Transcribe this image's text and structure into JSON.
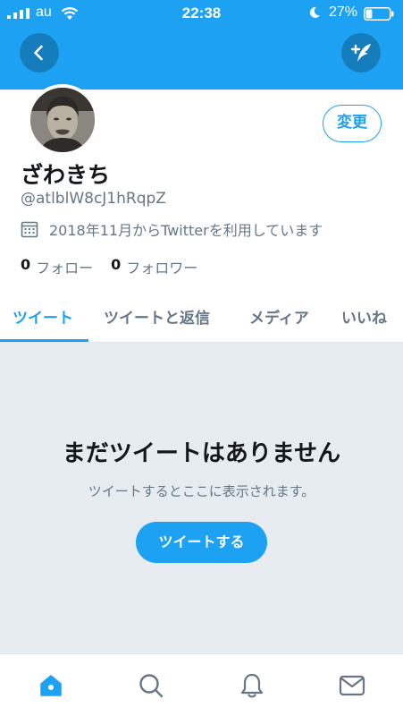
{
  "status_bar": {
    "carrier": "au",
    "time": "22:38",
    "battery_percent": "27%",
    "battery_level": 0.27,
    "icons": [
      "signal-icon",
      "wifi-icon",
      "moon-icon",
      "battery-icon"
    ]
  },
  "header": {
    "icons": [
      "back-arrow-icon",
      "compose-tweet-icon"
    ]
  },
  "profile": {
    "display_name": "ざわきち",
    "handle": "@atlblW8cJ1hRqpZ",
    "joined": "2018年11月からTwitterを利用しています",
    "edit_label": "変更",
    "following_count": "0",
    "following_label": "フォロー",
    "followers_count": "0",
    "followers_label": "フォロワー"
  },
  "tabs": [
    {
      "label": "ツイート",
      "active": true
    },
    {
      "label": "ツイートと返信",
      "active": false
    },
    {
      "label": "メディア",
      "active": false
    },
    {
      "label": "いいね",
      "active": false
    }
  ],
  "empty_state": {
    "title": "まだツイートはありません",
    "subtitle": "ツイートするとここに表示されます。",
    "button_label": "ツイートする"
  },
  "bottom_nav": {
    "items": [
      "home-icon",
      "search-icon",
      "notifications-icon",
      "messages-icon"
    ],
    "active": "home-icon"
  },
  "colors": {
    "brand": "#1da1f2",
    "text": "#14171a",
    "muted": "#657786",
    "empty_bg": "#e6ecf0"
  }
}
